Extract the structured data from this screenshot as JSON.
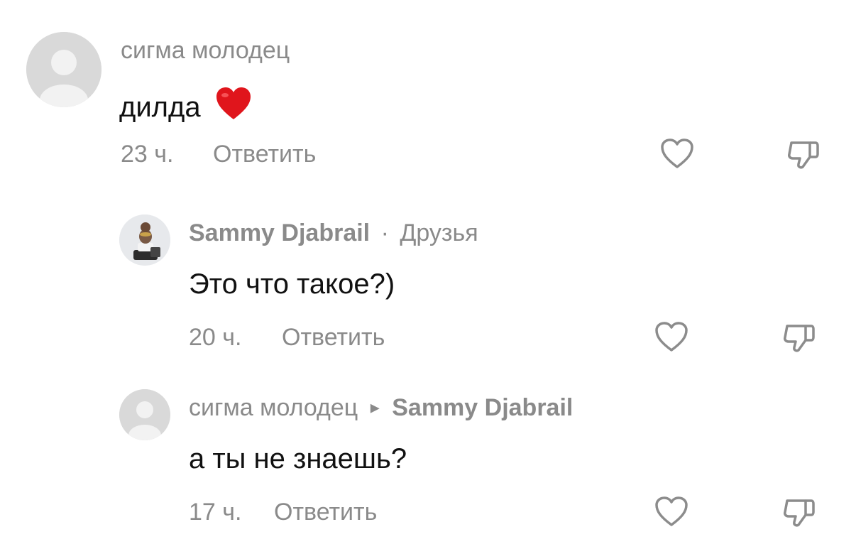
{
  "comments": [
    {
      "author": "сигма молодец",
      "text": "дилда",
      "emoji": "❤️",
      "time": "23 ч.",
      "reply_label": "Ответить"
    },
    {
      "author": "Sammy Djabrail",
      "separator": "·",
      "tag": "Друзья",
      "text": "Это что такое?)",
      "time": "20 ч.",
      "reply_label": "Ответить"
    },
    {
      "author": "сигма молодец",
      "reply_arrow": "▸",
      "reply_to": "Sammy Djabrail",
      "text": "а ты не знаешь?",
      "time": "17 ч.",
      "reply_label": "Ответить"
    }
  ],
  "icons": {
    "like": "heart-outline-icon",
    "dislike": "thumbs-down-outline-icon"
  },
  "colors": {
    "meta_text": "#8a8a8a",
    "body_text": "#111111",
    "icon_stroke": "#8c8c8c",
    "avatar_placeholder": "#d9d9d9",
    "heart_emoji": "#e0151c"
  }
}
